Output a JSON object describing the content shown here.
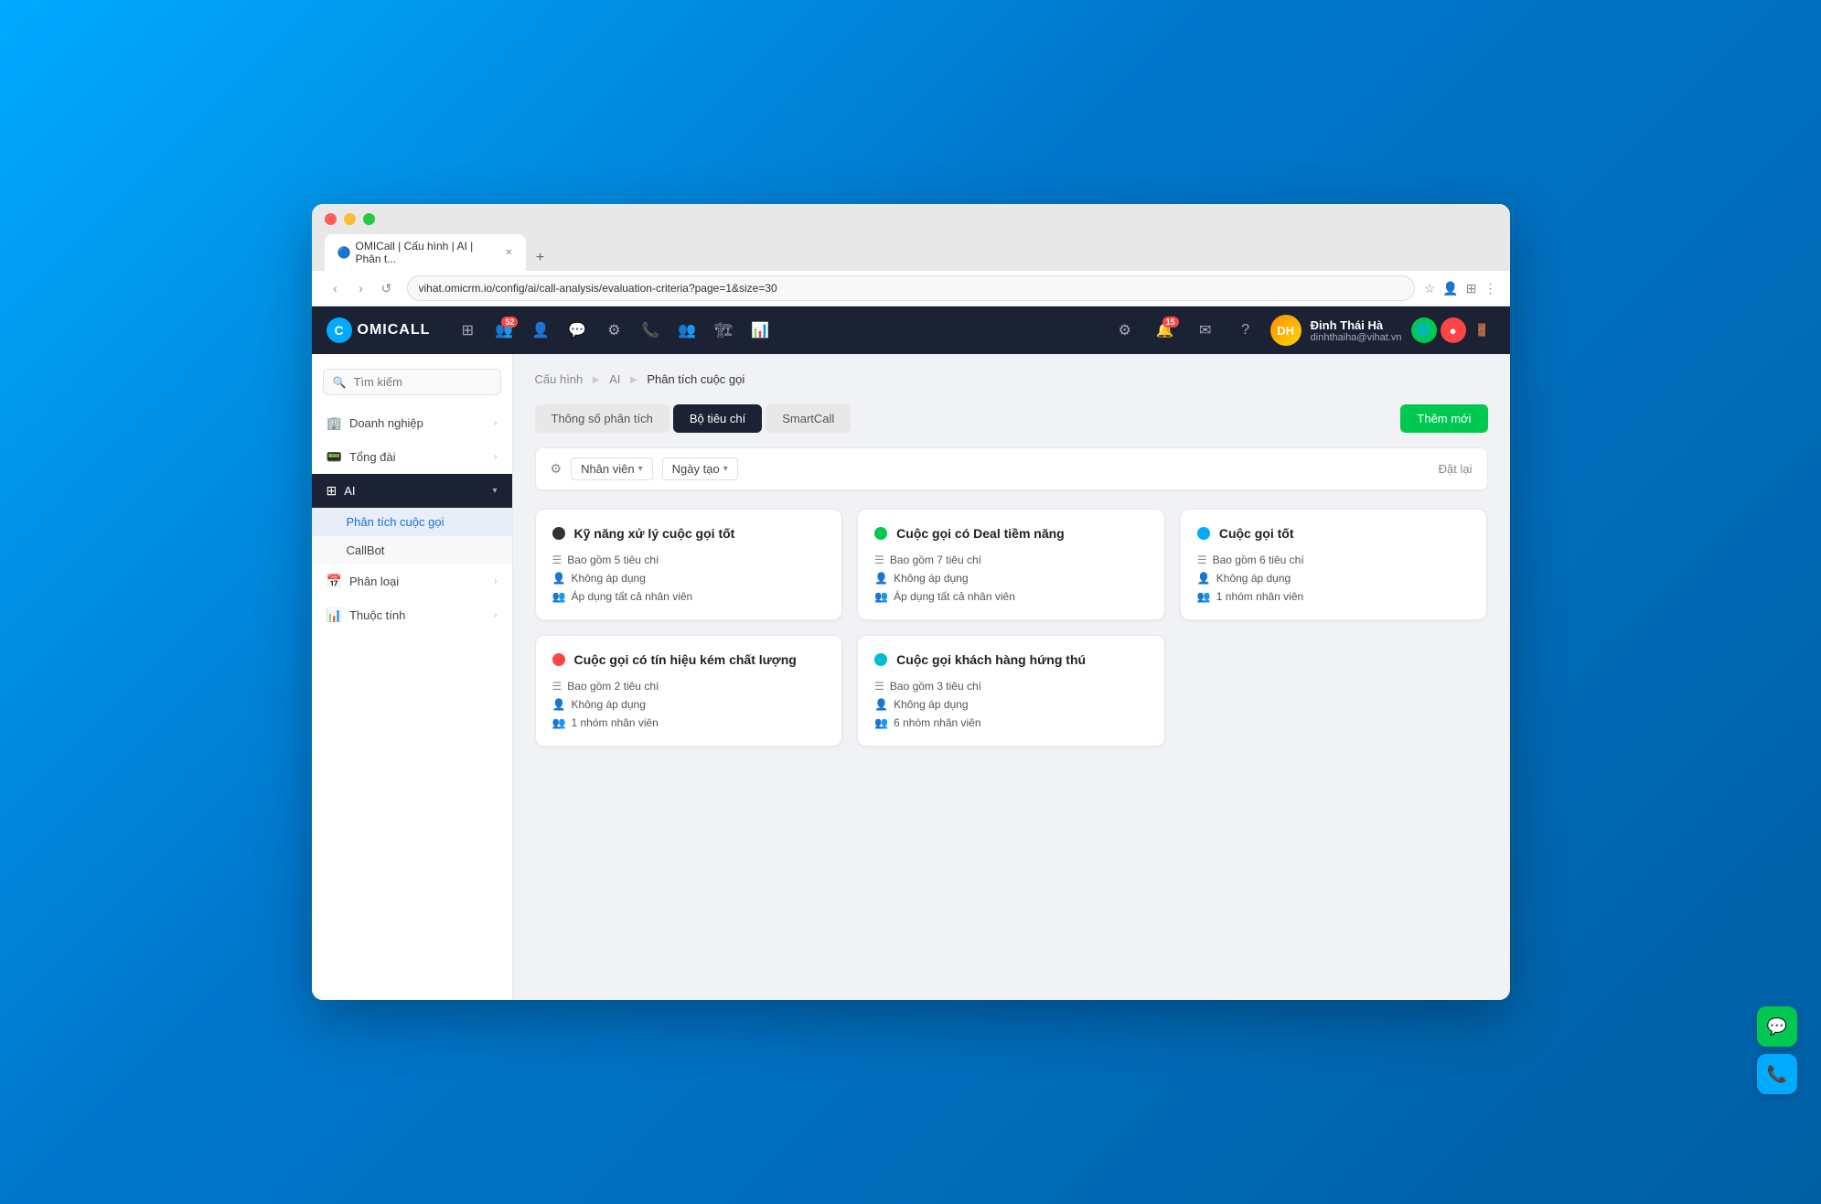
{
  "browser": {
    "tab_title": "OMICall | Cấu hình | AI | Phân t...",
    "tab_favicon": "C",
    "url": "vihat.omicrm.io/config/ai/call-analysis/evaluation-criteria?page=1&size=30",
    "new_tab_label": "+"
  },
  "nav": {
    "logo_text": "OMICALL",
    "badge_52": "52",
    "badge_15": "15",
    "user_name": "Đinh Thái Hà",
    "user_email": "dinhthaiha@vihat.vn",
    "user_initials": "DH"
  },
  "breadcrumb": {
    "item1": "Cấu hình",
    "item2": "AI",
    "item3": "Phân tích cuộc gọi"
  },
  "sidebar": {
    "search_placeholder": "Tìm kiếm",
    "items": [
      {
        "icon": "🏢",
        "label": "Doanh nghiệp",
        "has_arrow": true
      },
      {
        "icon": "📞",
        "label": "Tổng đài",
        "has_arrow": true
      },
      {
        "icon": "🤖",
        "label": "AI",
        "has_arrow": true,
        "active": true
      },
      {
        "icon": "📋",
        "label": "Phân loại",
        "has_arrow": true
      },
      {
        "icon": "📊",
        "label": "Thuộc tính",
        "has_arrow": true
      }
    ],
    "sub_items": [
      {
        "label": "Phân tích cuộc gọi",
        "active": true
      },
      {
        "label": "CallBot"
      }
    ]
  },
  "tabs": [
    {
      "label": "Thông số phân tích",
      "active": false
    },
    {
      "label": "Bộ tiêu chí",
      "active": true
    },
    {
      "label": "SmartCall",
      "active": false
    }
  ],
  "add_button": "Thêm mới",
  "filters": {
    "icon": "⚙",
    "filter1": "Nhân viên",
    "filter2": "Ngày tạo",
    "reset": "Đặt lại"
  },
  "cards": [
    {
      "dot": "dark",
      "title": "Kỹ năng xử lý cuộc gọi tốt",
      "criteria_count": "Bao gồm 5 tiêu chí",
      "apply_user": "Không áp dụng",
      "apply_group": "Áp dụng tất cả nhân viên"
    },
    {
      "dot": "green",
      "title": "Cuộc gọi có Deal tiềm năng",
      "criteria_count": "Bao gồm 7 tiêu chí",
      "apply_user": "Không áp dụng",
      "apply_group": "Áp dụng tất cả nhân viên"
    },
    {
      "dot": "blue",
      "title": "Cuộc gọi tốt",
      "criteria_count": "Bao gồm 6 tiêu chí",
      "apply_user": "Không áp dụng",
      "apply_group": "1 nhóm nhân viên"
    },
    {
      "dot": "red",
      "title": "Cuộc gọi có tín hiệu kém chất lượng",
      "criteria_count": "Bao gồm 2 tiêu chí",
      "apply_user": "Không áp dụng",
      "apply_group": "1 nhóm nhân viên"
    },
    {
      "dot": "teal",
      "title": "Cuộc gọi khách hàng hứng thú",
      "criteria_count": "Bao gồm 3 tiêu chí",
      "apply_user": "Không áp dụng",
      "apply_group": "6 nhóm nhân viên"
    }
  ]
}
